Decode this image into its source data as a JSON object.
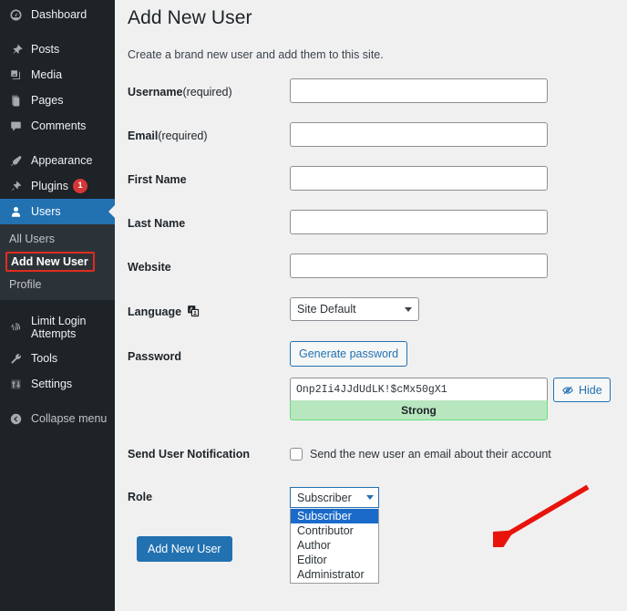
{
  "sidebar": {
    "items": [
      {
        "label": "Dashboard",
        "icon": "dashboard-icon",
        "name": "dashboard"
      },
      {
        "label": "Posts",
        "icon": "pin-icon",
        "name": "posts"
      },
      {
        "label": "Media",
        "icon": "media-icon",
        "name": "media"
      },
      {
        "label": "Pages",
        "icon": "pages-icon",
        "name": "pages"
      },
      {
        "label": "Comments",
        "icon": "comment-icon",
        "name": "comments"
      },
      {
        "label": "Appearance",
        "icon": "brush-icon",
        "name": "appearance"
      },
      {
        "label": "Plugins",
        "icon": "plug-icon",
        "name": "plugins",
        "badge": "1"
      },
      {
        "label": "Users",
        "icon": "user-icon",
        "name": "users",
        "current": true
      },
      {
        "label": "Limit Login Attempts",
        "icon": "fingerprint-icon",
        "name": "limit-login-attempts"
      },
      {
        "label": "Tools",
        "icon": "wrench-icon",
        "name": "tools"
      },
      {
        "label": "Settings",
        "icon": "sliders-icon",
        "name": "settings"
      },
      {
        "label": "Collapse menu",
        "icon": "collapse-icon",
        "name": "collapse-menu"
      }
    ],
    "users_submenu": [
      {
        "label": "All Users",
        "name": "all-users",
        "highlighted": false
      },
      {
        "label": "Add New User",
        "name": "add-new-user",
        "highlighted": true
      },
      {
        "label": "Profile",
        "name": "profile",
        "highlighted": false
      }
    ]
  },
  "page": {
    "title": "Add New User",
    "description": "Create a brand new user and add them to this site."
  },
  "form": {
    "fields": [
      {
        "label": "Username",
        "suffix": " (required)",
        "value": "",
        "name": "username"
      },
      {
        "label": "Email",
        "suffix": " (required)",
        "value": "",
        "name": "email"
      },
      {
        "label": "First Name",
        "suffix": "",
        "value": "",
        "name": "first-name"
      },
      {
        "label": "Last Name",
        "suffix": "",
        "value": "",
        "name": "last-name"
      },
      {
        "label": "Website",
        "suffix": "",
        "value": "",
        "name": "website"
      }
    ],
    "language": {
      "label": "Language",
      "selected": "Site Default",
      "icon": "translation-icon"
    },
    "password": {
      "label": "Password",
      "generate_button": "Generate password",
      "value": "Onp2Ii4JJdUdLK!$cMx50gX1",
      "strength": "Strong",
      "hide_button": "Hide",
      "hide_icon": "eye-slash-icon",
      "strength_bg": "#b8e6bf",
      "strength_border": "#68de7c"
    },
    "notification": {
      "label": "Send User Notification",
      "checkbox_label": "Send the new user an email about their account",
      "checked": false
    },
    "role": {
      "label": "Role",
      "selected": "Subscriber",
      "options": [
        "Subscriber",
        "Contributor",
        "Author",
        "Editor",
        "Administrator"
      ],
      "open": true
    },
    "submit_label": "Add New User"
  },
  "annotation": {
    "arrow_color": "#e8140c",
    "highlight_color": "#e02b20"
  },
  "colors": {
    "sidebar_bg": "#1d2327",
    "submenu_bg": "#2c3338",
    "accent": "#2271b1",
    "page_bg": "#f0f0f1"
  }
}
